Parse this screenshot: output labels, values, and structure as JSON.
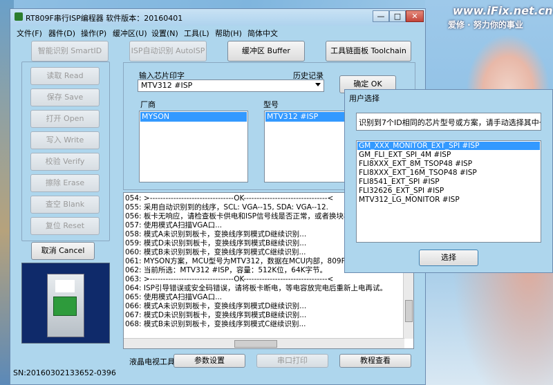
{
  "desktop": {
    "watermark": "www.iFix.net.cn",
    "slogan": "爱修 · 努力你的事业"
  },
  "window": {
    "title": "RT809F串行ISP编程器  软件版本：20160401",
    "controls": {
      "minimize": "—",
      "maximize": "□",
      "close": "✕"
    }
  },
  "menu": [
    "文件(F)",
    "器件(D)",
    "操作(P)",
    "缓冲区(U)",
    "设置(N)",
    "工具(L)",
    "帮助(H)",
    "简体中文"
  ],
  "toolbar": {
    "smart_id": "智能识别 SmartID",
    "auto_isp": "ISP自动识别 AutoISP",
    "buffer": "缓冲区 Buffer",
    "toolchain": "工具链面板 Toolchain"
  },
  "side_buttons": [
    "读取 Read",
    "保存 Save",
    "打开 Open",
    "写入 Write",
    "校验 Verify",
    "擦除 Erase",
    "查空 Blank",
    "复位 Reset"
  ],
  "cancel_button": "取消 Cancel",
  "chip": {
    "input_label": "输入芯片印字",
    "history_label": "历史记录",
    "selected": "MTV312 #ISP",
    "confirm": "确定 OK",
    "vendor_label": "厂商",
    "vendor_selected": "MYSON",
    "model_label": "型号",
    "model_selected": "MTV312 #ISP"
  },
  "log": [
    "054:  >--------------------------------OK--------------------------------<",
    "055:  采用自动识别到的线序，SCL: VGA--15, SDA: VGA--12.",
    "056:  板卡无响应，请检查板卡供电和ISP信号线是否正常，或者换块板",
    "057:  使用模式A扫描VGA口...",
    "058:  模式A未识别到板卡，变换线序到模式D继续识别...",
    "059:  模式D未识别到板卡，变换线序到模式B继续识别...",
    "060:  模式B未识别到板卡，变换线序到模式C继续识别...",
    "061:  MYSON方案，MCU型号为MTV312，数据在MCU内部，809F协",
    "062:  当前所选：MTV312 #ISP，容量：512K位，64K字节。",
    "063:  >--------------------------------OK--------------------------------<",
    "064:  ISP引导错误或安全码错误，请将板卡断电，等电容放完电后重新上电再试。",
    "065:  使用模式A扫描VGA口...",
    "066:  模式A未识别到板卡，变换线序到模式D继续识别...",
    "067:  模式D未识别到板卡，变换线序到模式B继续识别...",
    "068:  模式B未识别到板卡，变换线序到模式C继续识别..."
  ],
  "bottom": {
    "label": "液晶电视工具",
    "params": "参数设置",
    "serial_print": "串口打印",
    "tutorial": "教程查看"
  },
  "status": {
    "sn": "SN:20160302133652-0396"
  },
  "dialog": {
    "title": "用户选择",
    "message": "识别到7个ID相同的芯片型号或方案，请手动选择其中一个",
    "items": [
      "GM_XXX_MONITOR_EXT_SPI #ISP",
      "GM_FLI_EXT_SPI_4M #ISP",
      "FLI8XXX_EXT_8M_TSOP48 #ISP",
      "FLI8XXX_EXT_16M_TSOP48 #ISP",
      "FLI8541_EXT_SPI #ISP",
      "FLI32626_EXT_SPI #ISP",
      "MTV312_LG_MONITOR #ISP"
    ],
    "selected_index": 0,
    "select_button": "选择"
  },
  "colors": {
    "window_bg": "#aed6ed",
    "selection": "#3399ff"
  }
}
